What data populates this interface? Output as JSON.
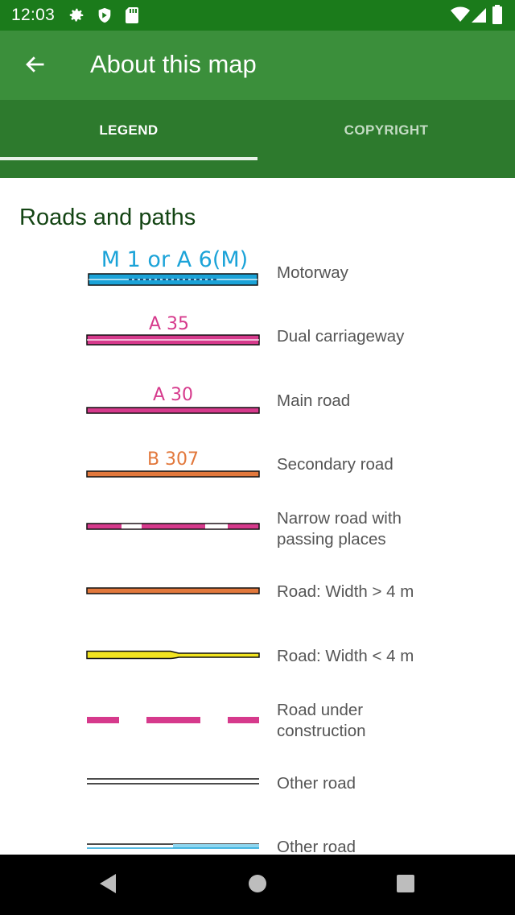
{
  "status_bar": {
    "time": "12:03",
    "icons": [
      "gear-icon",
      "shield-icon",
      "sd-card-icon",
      "wifi-icon",
      "signal-icon",
      "battery-icon"
    ]
  },
  "app_bar": {
    "title": "About this map",
    "back_icon": "arrow-left-icon"
  },
  "tabs": [
    {
      "label": "LEGEND",
      "selected": true
    },
    {
      "label": "COPYRIGHT",
      "selected": false
    }
  ],
  "legend": {
    "section_title": "Roads and paths",
    "items": [
      {
        "label": "Motorway",
        "symbol_text": "M 1 or A 6(M)",
        "symbol_color": "#1ba3d8"
      },
      {
        "label": "Dual carriageway",
        "symbol_text": "A 35",
        "symbol_color": "#d63a8c"
      },
      {
        "label": "Main road",
        "symbol_text": "A 30",
        "symbol_color": "#d63a8c"
      },
      {
        "label": "Secondary road",
        "symbol_text": "B 307",
        "symbol_color": "#e2783c"
      },
      {
        "label": "Narrow road with passing places",
        "symbol_text": "",
        "symbol_color": "#d63a8c"
      },
      {
        "label": "Road: Width > 4 m",
        "symbol_text": "",
        "symbol_color": "#e2783c"
      },
      {
        "label": "Road: Width < 4 m",
        "symbol_text": "",
        "symbol_color": "#f2e420"
      },
      {
        "label": "Road under construction",
        "symbol_text": "",
        "symbol_color": "#d63a8c"
      },
      {
        "label": "Other road",
        "symbol_text": "",
        "symbol_color": "#ffffff"
      },
      {
        "label": "Other road",
        "symbol_text": "",
        "symbol_color": "#8fd6f0"
      }
    ]
  },
  "nav_bar": {
    "icons": [
      "back-triangle-icon",
      "home-circle-icon",
      "recents-square-icon"
    ]
  }
}
